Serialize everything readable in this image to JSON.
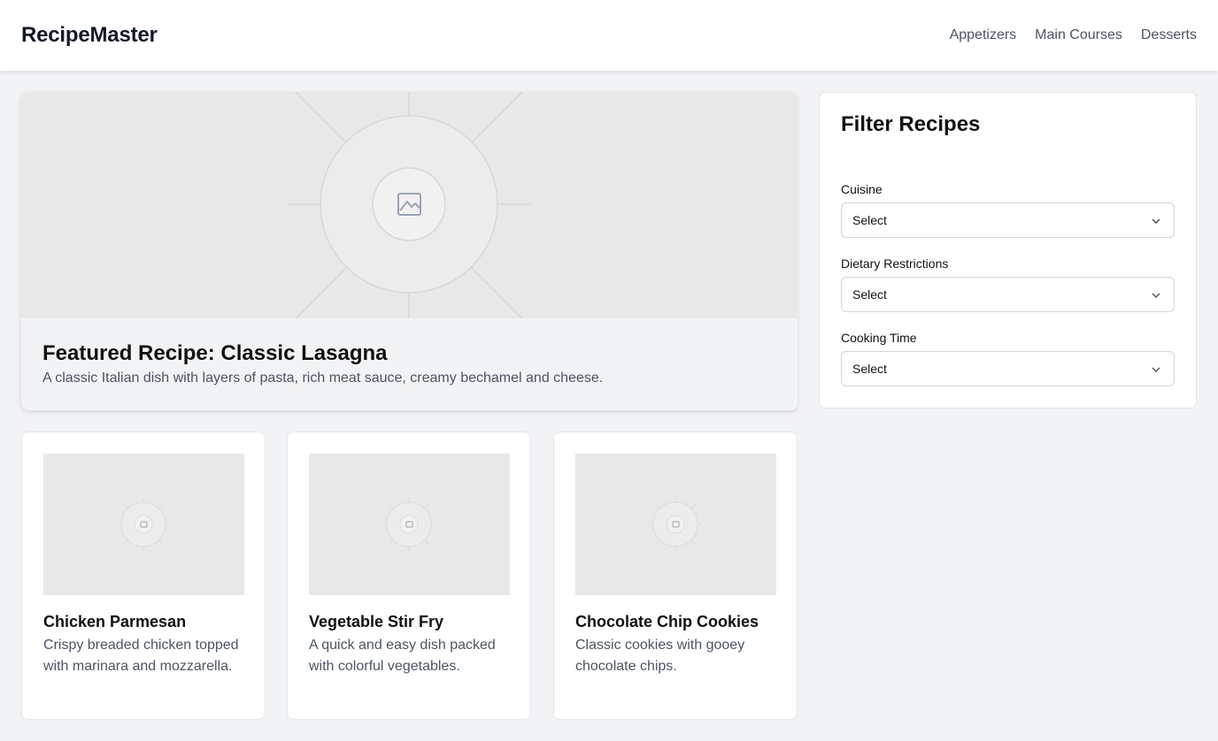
{
  "header": {
    "brand": "RecipeMaster",
    "nav": [
      "Appetizers",
      "Main Courses",
      "Desserts"
    ]
  },
  "featured": {
    "title": "Featured Recipe: Classic Lasagna",
    "description": "A classic Italian dish with layers of pasta, rich meat sauce, creamy bechamel and cheese.",
    "image_icon": "image-placeholder-icon"
  },
  "filter": {
    "title": "Filter Recipes",
    "fields": [
      {
        "label": "Cuisine",
        "value": "Select"
      },
      {
        "label": "Dietary Restrictions",
        "value": "Select"
      },
      {
        "label": "Cooking Time",
        "value": "Select"
      }
    ]
  },
  "cards": [
    {
      "title": "Chicken Parmesan",
      "description": "Crispy breaded chicken topped with marinara and mozzarella."
    },
    {
      "title": "Vegetable Stir Fry",
      "description": "A quick and easy dish packed with colorful vegetables."
    },
    {
      "title": "Chocolate Chip Cookies",
      "description": "Classic cookies with gooey chocolate chips."
    }
  ],
  "colors": {
    "background": "#f2f3f5",
    "surface": "#ffffff",
    "placeholder": "#e8e8e8",
    "text_primary": "#111827",
    "text_secondary": "#4b5563",
    "border": "#e5e7eb"
  }
}
